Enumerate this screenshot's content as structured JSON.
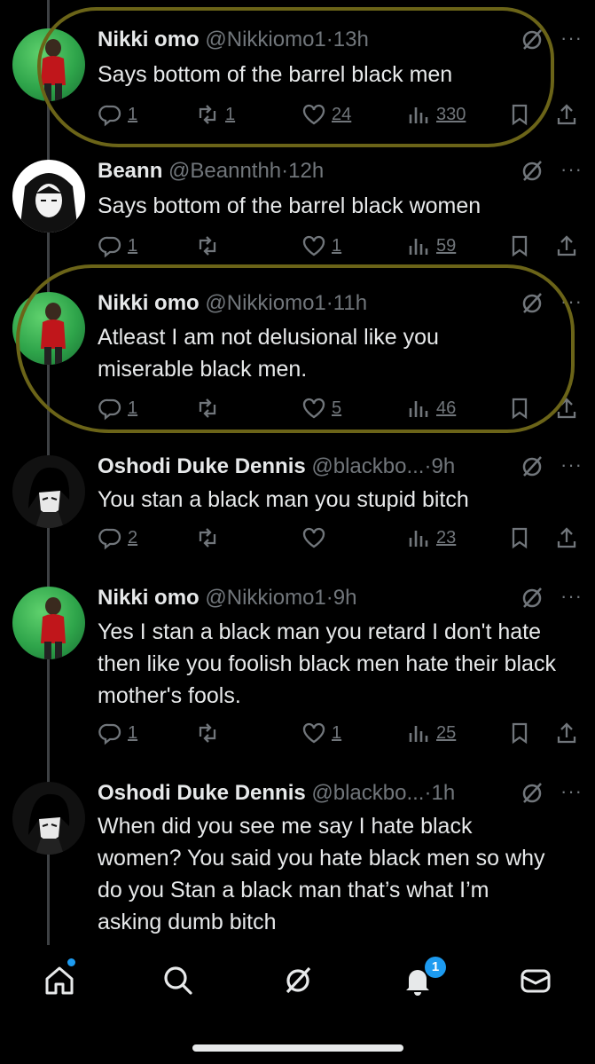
{
  "tweets": [
    {
      "name": "Nikki omo",
      "handle": "@Nikkiomo1",
      "time": "13h",
      "text": "Says bottom of the barrel black men",
      "replies": "1",
      "retweets": "1",
      "likes": "24",
      "views": "330"
    },
    {
      "name": "Beann",
      "handle": "@Beannthh",
      "time": "12h",
      "text": "Says bottom of the barrel black women",
      "replies": "1",
      "retweets": "",
      "likes": "1",
      "views": "59"
    },
    {
      "name": "Nikki omo",
      "handle": "@Nikkiomo1",
      "time": "11h",
      "text": "Atleast I am not delusional like you miserable black men.",
      "replies": "1",
      "retweets": "",
      "likes": "5",
      "views": "46"
    },
    {
      "name": "Oshodi Duke Dennis",
      "handle": "@blackbo...",
      "time": "9h",
      "text": "You stan a black man you stupid bitch",
      "replies": "2",
      "retweets": "",
      "likes": "",
      "views": "23"
    },
    {
      "name": "Nikki omo",
      "handle": "@Nikkiomo1",
      "time": "9h",
      "text": "Yes I stan a black man you retard I don't hate then like you foolish black men hate their black mother's fools.",
      "replies": "1",
      "retweets": "",
      "likes": "1",
      "views": "25"
    },
    {
      "name": "Oshodi Duke Dennis",
      "handle": "@blackbo...",
      "time": "1h",
      "text": "When did you see me say I hate black women? You said you hate black men so why do you Stan a black man that’s what I’m asking dumb bitch"
    }
  ],
  "separator": "·",
  "more": "···",
  "nav": {
    "notifications_badge": "1"
  },
  "colors": {
    "background": "#000000",
    "text": "#e7e9ea",
    "muted": "#71767b",
    "accent": "#1d9bf0",
    "annotation": "#6b6418"
  }
}
